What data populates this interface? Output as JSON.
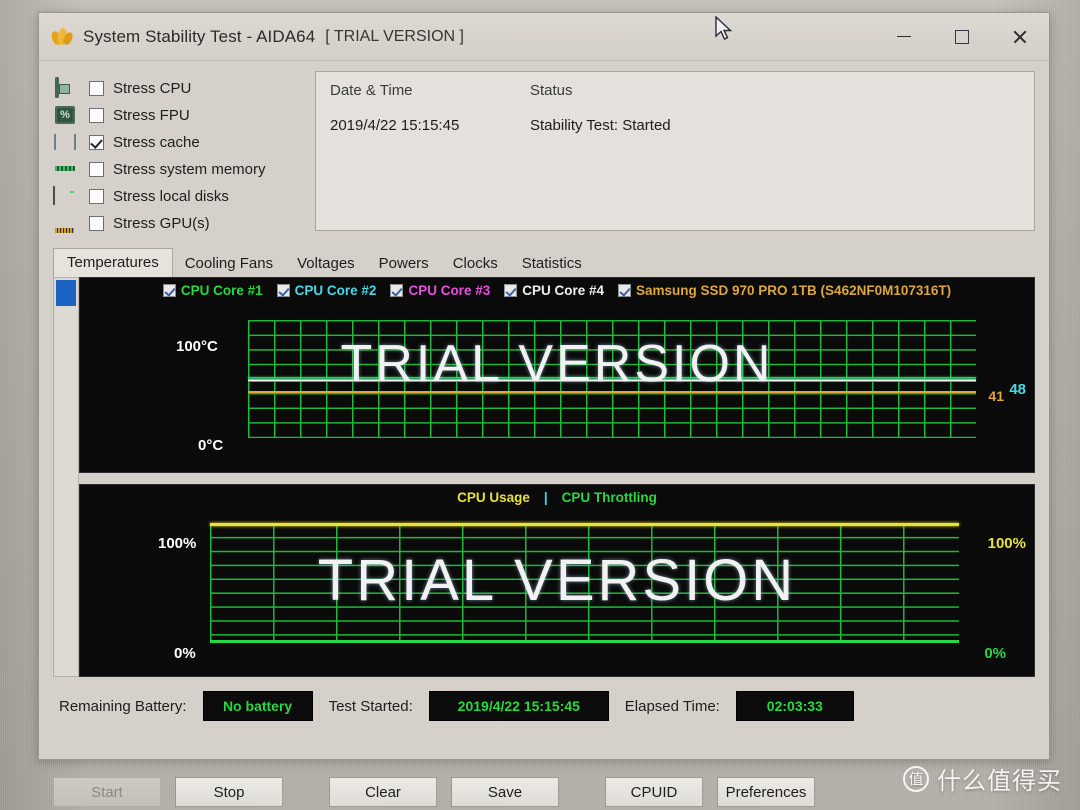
{
  "window": {
    "title": "System Stability Test - AIDA64",
    "trial_tag": "[ TRIAL VERSION ]",
    "app_icon": "flame-icon",
    "controls": {
      "minimize": "minimize-icon",
      "maximize": "maximize-icon",
      "close": "close-icon"
    }
  },
  "stress_options": [
    {
      "icon": "cpu-chip-icon",
      "label": "Stress CPU",
      "checked": false
    },
    {
      "icon": "fpu-percent-icon",
      "label": "Stress FPU",
      "checked": false
    },
    {
      "icon": "cache-chip-icon",
      "label": "Stress cache",
      "checked": true
    },
    {
      "icon": "memory-stick-icon",
      "label": "Stress system memory",
      "checked": false
    },
    {
      "icon": "hard-disk-icon",
      "label": "Stress local disks",
      "checked": false
    },
    {
      "icon": "gpu-card-icon",
      "label": "Stress GPU(s)",
      "checked": false
    }
  ],
  "status_panel": {
    "col_datetime": "Date & Time",
    "col_status": "Status",
    "row_datetime": "2019/4/22 15:15:45",
    "row_status": "Stability Test: Started"
  },
  "tabs": [
    {
      "label": "Temperatures",
      "active": true
    },
    {
      "label": "Cooling Fans",
      "active": false
    },
    {
      "label": "Voltages",
      "active": false
    },
    {
      "label": "Powers",
      "active": false
    },
    {
      "label": "Clocks",
      "active": false
    },
    {
      "label": "Statistics",
      "active": false
    }
  ],
  "temperature_graph": {
    "watermark": "TRIAL VERSION",
    "y_top_label": "100°C",
    "y_bottom_label": "0°C",
    "right_value_1": "41",
    "right_value_2": "48",
    "right_value_1_color": "#e0a53a",
    "right_value_2_color": "#46d9e6",
    "legend": [
      {
        "label": "CPU Core #1",
        "color": "#27d83f",
        "checked": true
      },
      {
        "label": "CPU Core #2",
        "color": "#46d9e6",
        "checked": true
      },
      {
        "label": "CPU Core #3",
        "color": "#ea4ce0",
        "checked": true
      },
      {
        "label": "CPU Core #4",
        "color": "#f0f0f0",
        "checked": true
      },
      {
        "label": "Samsung SSD 970 PRO 1TB (S462NF0M107316T)",
        "color": "#e0a53a",
        "checked": true
      }
    ]
  },
  "usage_graph": {
    "watermark": "TRIAL VERSION",
    "title_usage": "CPU Usage",
    "title_separator": "|",
    "title_throttling": "CPU Throttling",
    "usage_color": "#e8e332",
    "throttling_color": "#27d83f",
    "y_top_left": "100%",
    "y_bottom_left": "0%",
    "y_top_right": "100%",
    "y_bottom_right": "0%"
  },
  "chart_data": [
    {
      "type": "line",
      "title": "Temperatures",
      "ylabel": "°C",
      "ylim": [
        0,
        100
      ],
      "grid": true,
      "legend_position": "top",
      "series": [
        {
          "name": "CPU Core #1",
          "color": "#27d83f",
          "current": 48
        },
        {
          "name": "CPU Core #2",
          "color": "#46d9e6",
          "current": 48
        },
        {
          "name": "CPU Core #3",
          "color": "#ea4ce0",
          "current": 47
        },
        {
          "name": "CPU Core #4",
          "color": "#f0f0f0",
          "current": 47
        },
        {
          "name": "Samsung SSD 970 PRO 1TB (S462NF0M107316T)",
          "color": "#e0a53a",
          "current": 41
        }
      ]
    },
    {
      "type": "line",
      "title": "CPU Usage | CPU Throttling",
      "ylabel": "%",
      "ylim": [
        0,
        100
      ],
      "grid": true,
      "legend_position": "top",
      "series": [
        {
          "name": "CPU Usage",
          "color": "#e8e332",
          "current": 100
        },
        {
          "name": "CPU Throttling",
          "color": "#27d83f",
          "current": 0
        }
      ]
    }
  ],
  "status_bar": {
    "battery_label": "Remaining Battery:",
    "battery_value": "No battery",
    "started_label": "Test Started:",
    "started_value": "2019/4/22 15:15:45",
    "elapsed_label": "Elapsed Time:",
    "elapsed_value": "02:03:33"
  },
  "buttons": [
    {
      "label": "Start",
      "disabled": true
    },
    {
      "label": "Stop",
      "disabled": false
    },
    {
      "label": "Clear",
      "disabled": false
    },
    {
      "label": "Save",
      "disabled": false
    },
    {
      "label": "CPUID",
      "disabled": false
    },
    {
      "label": "Preferences",
      "disabled": false
    }
  ],
  "overlay_watermark": {
    "badge": "值",
    "text": "什么值得买"
  }
}
